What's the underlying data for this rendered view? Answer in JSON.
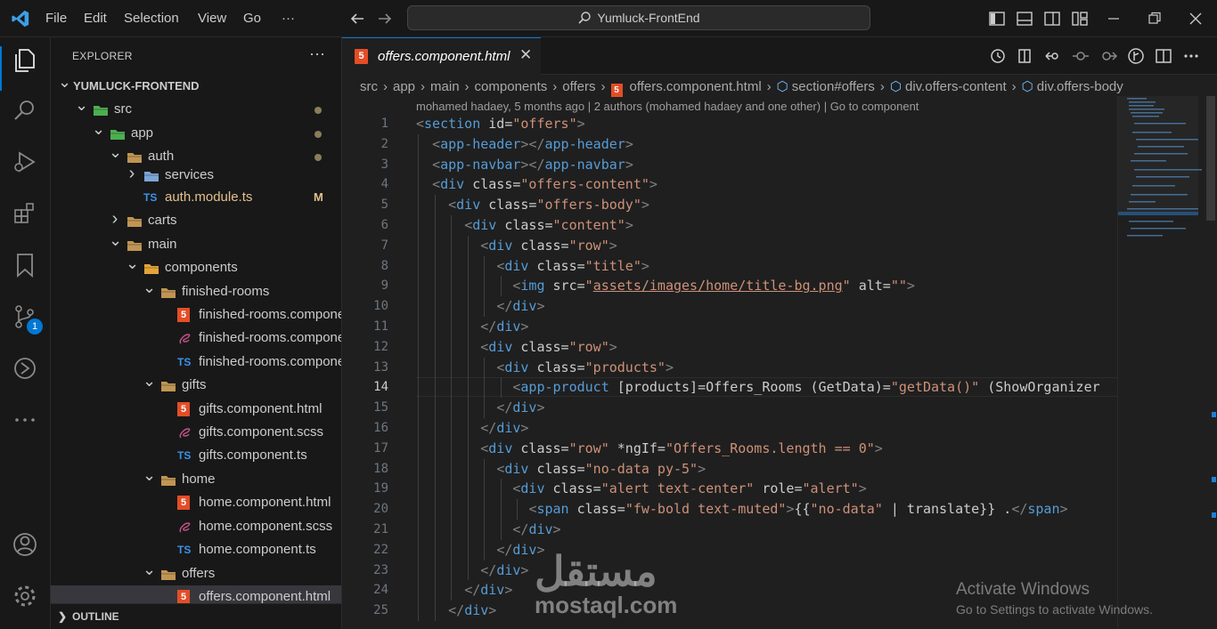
{
  "menubar": {
    "items": [
      "File",
      "Edit",
      "Selection",
      "View",
      "Go"
    ],
    "more": "···",
    "search": "Yumluck-FrontEnd"
  },
  "activity": {
    "source_control_badge": "1"
  },
  "sidebar": {
    "title": "EXPLORER",
    "more": "···",
    "outline_label": "OUTLINE",
    "tree": [
      {
        "label": "YUMLUCK-FRONTEND",
        "depth": 0,
        "chevron": "down",
        "kind": "root"
      },
      {
        "label": "src",
        "depth": 1,
        "chevron": "down",
        "kind": "folder-green",
        "dot": true
      },
      {
        "label": "app",
        "depth": 2,
        "chevron": "down",
        "kind": "folder-green",
        "dot": true
      },
      {
        "label": "auth",
        "depth": 3,
        "chevron": "down",
        "kind": "folder",
        "dot": true
      },
      {
        "label": "services",
        "depth": 4,
        "chevron": "right",
        "kind": "folder-blue"
      },
      {
        "label": "auth.module.ts",
        "depth": 4,
        "chevron": "",
        "kind": "ts",
        "modified": "M",
        "color": "#e2c08d"
      },
      {
        "label": "carts",
        "depth": 3,
        "chevron": "right",
        "kind": "folder"
      },
      {
        "label": "main",
        "depth": 3,
        "chevron": "down",
        "kind": "folder"
      },
      {
        "label": "components",
        "depth": 4,
        "chevron": "down",
        "kind": "folder-orange"
      },
      {
        "label": "finished-rooms",
        "depth": 5,
        "chevron": "down",
        "kind": "folder"
      },
      {
        "label": "finished-rooms.component.h...",
        "depth": 6,
        "chevron": "",
        "kind": "html"
      },
      {
        "label": "finished-rooms.component.s...",
        "depth": 6,
        "chevron": "",
        "kind": "scss"
      },
      {
        "label": "finished-rooms.component.ts",
        "depth": 6,
        "chevron": "",
        "kind": "ts"
      },
      {
        "label": "gifts",
        "depth": 5,
        "chevron": "down",
        "kind": "folder"
      },
      {
        "label": "gifts.component.html",
        "depth": 6,
        "chevron": "",
        "kind": "html"
      },
      {
        "label": "gifts.component.scss",
        "depth": 6,
        "chevron": "",
        "kind": "scss"
      },
      {
        "label": "gifts.component.ts",
        "depth": 6,
        "chevron": "",
        "kind": "ts"
      },
      {
        "label": "home",
        "depth": 5,
        "chevron": "down",
        "kind": "folder"
      },
      {
        "label": "home.component.html",
        "depth": 6,
        "chevron": "",
        "kind": "html"
      },
      {
        "label": "home.component.scss",
        "depth": 6,
        "chevron": "",
        "kind": "scss"
      },
      {
        "label": "home.component.ts",
        "depth": 6,
        "chevron": "",
        "kind": "ts"
      },
      {
        "label": "offers",
        "depth": 5,
        "chevron": "down",
        "kind": "folder"
      },
      {
        "label": "offers.component.html",
        "depth": 6,
        "chevron": "",
        "kind": "html",
        "selected": true
      }
    ]
  },
  "editor": {
    "tab_label": "offers.component.html",
    "tab_close": "✕",
    "breadcrumb": [
      "src",
      "app",
      "main",
      "components",
      "offers",
      "offers.component.html",
      "section#offers",
      "div.offers-content",
      "div.offers-body"
    ],
    "blame": "mohamed hadaey, 5 months ago | 2 authors (mohamed hadaey and one other) | Go to component",
    "first_line_number": 1,
    "current_line": 14,
    "lines": [
      "<section id=\"offers\">",
      "  <app-header></app-header>",
      "  <app-navbar></app-navbar>",
      "  <div class=\"offers-content\">",
      "    <div class=\"offers-body\">",
      "      <div class=\"content\">",
      "        <div class=\"row\">",
      "          <div class=\"title\">",
      "            <img src=\"assets/images/home/title-bg.png\" alt=\"\">",
      "          </div>",
      "        </div>",
      "        <div class=\"row\">",
      "          <div class=\"products\">",
      "            <app-product [products]=Offers_Rooms (GetData)=\"getData()\" (ShowOrganizer",
      "          </div>",
      "        </div>",
      "        <div class=\"row\" *ngIf=\"Offers_Rooms.length == 0\">",
      "          <div class=\"no-data py-5\">",
      "            <div class=\"alert text-center\" role=\"alert\">",
      "              <span class=\"fw-bold text-muted\">{{\"no-data\" | translate}} .</span>",
      "            </div>",
      "          </div>",
      "        </div>",
      "      </div>",
      "    </div>"
    ]
  },
  "overlay": {
    "watermark_logo": "مستقل",
    "watermark_url": "mostaql.com",
    "activate_title": "Activate Windows",
    "activate_sub": "Go to Settings to activate Windows."
  }
}
